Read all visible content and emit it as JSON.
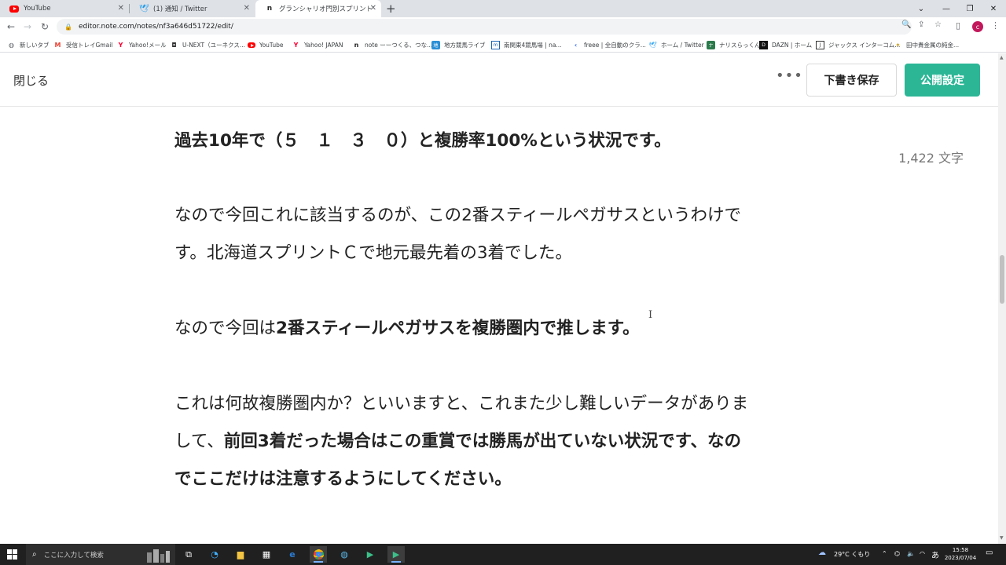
{
  "browser": {
    "tabs": [
      {
        "title": "YouTube",
        "favicon": "youtube-icon",
        "active": false
      },
      {
        "title": "(1) 通知 / Twitter",
        "favicon": "twitter-icon",
        "active": false
      },
      {
        "title": "グランシャリオ門別スプリント | 記事編",
        "favicon": "note-icon",
        "active": true
      }
    ],
    "new_tab_symbol": "+",
    "url": "editor.note.com/notes/nf3a646d51722/edit/",
    "profile_initial": "c",
    "bookmarks": [
      {
        "label": "新しいタブ",
        "icon": "globe-icon"
      },
      {
        "label": "受信トレイGmail",
        "icon": "gmail-icon"
      },
      {
        "label": "Yahoo!メール",
        "icon": "yahoo-icon"
      },
      {
        "label": "U-NEXT（ユーネクス...",
        "icon": "unext-icon"
      },
      {
        "label": "YouTube",
        "icon": "youtube-icon"
      },
      {
        "label": "Yahoo! JAPAN",
        "icon": "yahoo-icon"
      },
      {
        "label": "note ーーつくる、つな...",
        "icon": "note-icon"
      },
      {
        "label": "地方競馬ライブ",
        "icon": "keiba-icon"
      },
      {
        "label": "南関東4競馬場 | na...",
        "icon": "nankan-icon"
      },
      {
        "label": "freee | 全自動のクラ...",
        "icon": "freee-icon"
      },
      {
        "label": "ホーム / Twitter",
        "icon": "twitter-icon"
      },
      {
        "label": "ナリスらっくん",
        "icon": "naris-icon"
      },
      {
        "label": "DAZN | ホーム",
        "icon": "dazn-icon"
      },
      {
        "label": "ジャックス インターコム...",
        "icon": "jaccs-icon"
      },
      {
        "label": "田中貴金属の純金...",
        "icon": "tanaka-icon"
      }
    ]
  },
  "editor": {
    "close_label": "閉じる",
    "more_label": "•••",
    "save_draft_label": "下書き保存",
    "publish_label": "公開設定",
    "char_count": "1,422 文字",
    "paragraphs": [
      [
        {
          "text": "過去10年で（５　１　３　０）と複勝率100%という状況です。",
          "bold": true
        }
      ],
      [
        {
          "text": "なので今回これに該当するのが、この2番スティールペガサスというわけで",
          "bold": false
        }
      ],
      [
        {
          "text": "す。北海道スプリントＣで地元最先着の3着でした。",
          "bold": false
        }
      ],
      [
        {
          "text": "なので今回は",
          "bold": false
        },
        {
          "text": "2番スティールペガサスを複勝圏内で推します。",
          "bold": true
        }
      ],
      [
        {
          "text": "これは何故複勝圏内か？といいますと、これまた少し難しいデータがありま",
          "bold": false
        }
      ],
      [
        {
          "text": "して、",
          "bold": false
        },
        {
          "text": "前回3着だった場合はこの重賞では勝馬が出ていない状況です、なの",
          "bold": true
        }
      ],
      [
        {
          "text": "でここだけは注意するようにしてください。",
          "bold": true
        }
      ]
    ]
  },
  "taskbar": {
    "search_placeholder": "ここに入力して検索",
    "weather": "29°C くもり",
    "ime": "あ",
    "time": "15:58",
    "date": "2023/07/04"
  }
}
